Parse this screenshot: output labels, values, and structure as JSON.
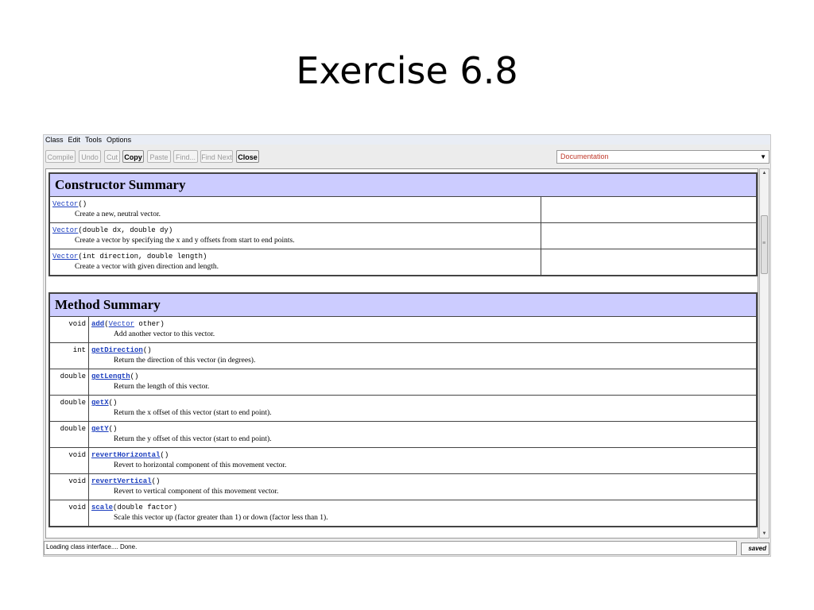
{
  "slide": {
    "title": "Exercise 6.8"
  },
  "menubar": {
    "items": [
      "Class",
      "Edit",
      "Tools",
      "Options"
    ]
  },
  "toolbar": {
    "buttons": [
      "Compile",
      "Undo",
      "Cut",
      "Copy",
      "Paste",
      "Find...",
      "Find Next",
      "Close"
    ],
    "view_select": "Documentation"
  },
  "constructor_summary": {
    "heading": "Constructor Summary",
    "rows": [
      {
        "name": "Vector",
        "params": "()",
        "desc": "Create a new, neutral vector."
      },
      {
        "name": "Vector",
        "params": "(double dx, double dy)",
        "desc": "Create a vector by specifying the x and y offsets from start to end points."
      },
      {
        "name": "Vector",
        "params": "(int direction, double length)",
        "desc": "Create a vector with given direction and length."
      }
    ]
  },
  "method_summary": {
    "heading": "Method Summary",
    "rows": [
      {
        "type": "void",
        "name": "add",
        "params_pre": "(",
        "param_link": "Vector",
        "params_post": " other)",
        "desc": "Add another vector to this vector."
      },
      {
        "type": "int",
        "name": "getDirection",
        "params_pre": "()",
        "param_link": "",
        "params_post": "",
        "desc": "Return the direction of this vector (in degrees)."
      },
      {
        "type": "double",
        "name": "getLength",
        "params_pre": "()",
        "param_link": "",
        "params_post": "",
        "desc": "Return the length of this vector."
      },
      {
        "type": "double",
        "name": "getX",
        "params_pre": "()",
        "param_link": "",
        "params_post": "",
        "desc": "Return the x offset of this vector (start to end point)."
      },
      {
        "type": "double",
        "name": "getY",
        "params_pre": "()",
        "param_link": "",
        "params_post": "",
        "desc": "Return the y offset of this vector (start to end point)."
      },
      {
        "type": "void",
        "name": "revertHorizontal",
        "params_pre": "()",
        "param_link": "",
        "params_post": "",
        "desc": "Revert to horizontal component of this movement vector."
      },
      {
        "type": "void",
        "name": "revertVertical",
        "params_pre": "()",
        "param_link": "",
        "params_post": "",
        "desc": "Revert to vertical component of this movement vector."
      },
      {
        "type": "void",
        "name": "scale",
        "params_pre": "(double factor)",
        "param_link": "",
        "params_post": "",
        "desc": "Scale this vector up (factor greater than 1) or down (factor less than 1)."
      }
    ]
  },
  "status": {
    "message": "Loading class interface.... Done.",
    "saved": "saved"
  }
}
